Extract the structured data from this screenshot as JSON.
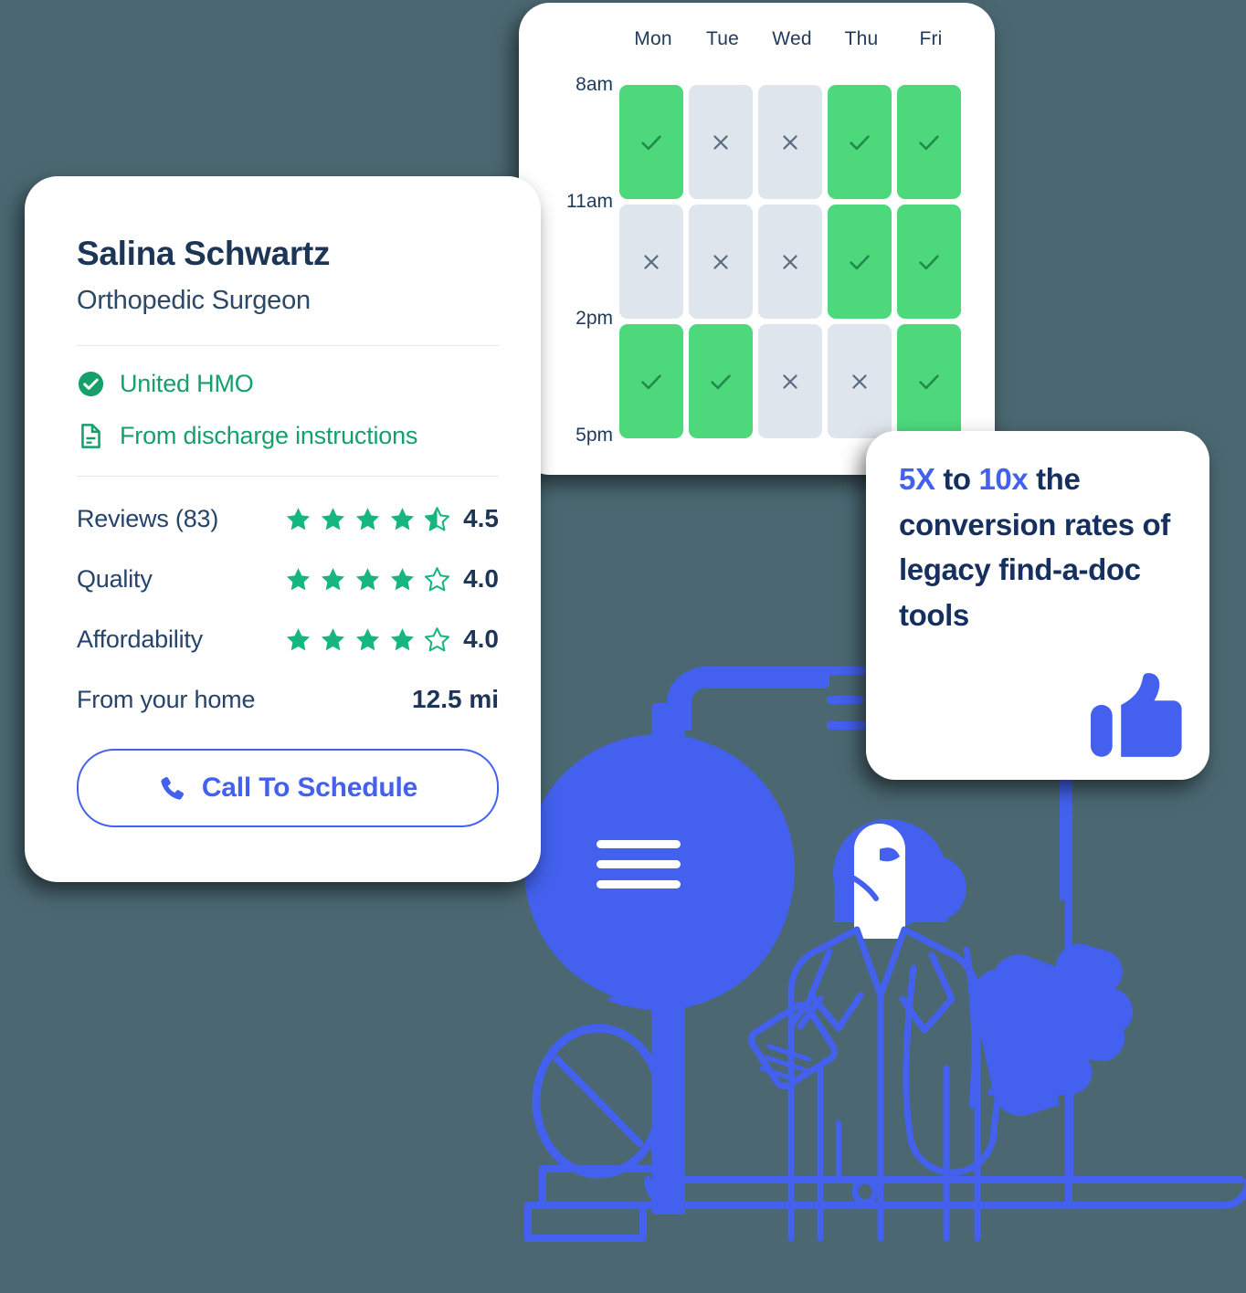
{
  "theme": {
    "background": "#4b6872",
    "card_bg": "#ffffff",
    "accent_blue": "#4361ee",
    "navy": "#1d3557",
    "green_open": "#4dd87b",
    "gray_closed": "#dfe5ec",
    "green_text": "#15a06a"
  },
  "schedule": {
    "days": [
      "Mon",
      "Tue",
      "Wed",
      "Thu",
      "Fri"
    ],
    "times": [
      "8am",
      "11am",
      "2pm",
      "5pm"
    ],
    "rows": [
      {
        "time_start": "8am",
        "time_end": "11am",
        "cells": [
          "available",
          "unavailable",
          "unavailable",
          "available",
          "available"
        ]
      },
      {
        "time_start": "11am",
        "time_end": "2pm",
        "cells": [
          "unavailable",
          "unavailable",
          "unavailable",
          "available",
          "available"
        ]
      },
      {
        "time_start": "2pm",
        "time_end": "5pm",
        "cells": [
          "available",
          "available",
          "unavailable",
          "unavailable",
          "available"
        ]
      }
    ],
    "icon_available": "check-icon",
    "icon_unavailable": "close-icon"
  },
  "profile": {
    "name": "Salina Schwartz",
    "specialty": "Orthopedic Surgeon",
    "tags": [
      {
        "icon": "check-circle-icon",
        "label": "United HMO"
      },
      {
        "icon": "document-icon",
        "label": "From discharge instructions"
      }
    ],
    "ratings": [
      {
        "label": "Reviews (83)",
        "stars": 4.5,
        "value": "4.5"
      },
      {
        "label": "Quality",
        "stars": 4.0,
        "value": "4.0"
      },
      {
        "label": "Affordability",
        "stars": 4.0,
        "value": "4.0"
      }
    ],
    "distance": {
      "label": "From your home",
      "value": "12.5 mi"
    },
    "cta": {
      "icon": "phone-icon",
      "label": "Call To Schedule"
    }
  },
  "stat": {
    "line1_highlight_a": "5X",
    "line1_mid": " to ",
    "line1_highlight_b": "10x",
    "line1_tail": " the",
    "line2": "conversion rates",
    "line3": "of legacy",
    "line4": "find-a-doc tools",
    "full_text": "5X to 10x the conversion rates of legacy find-a-doc tools",
    "icon": "thumbs-up-icon"
  },
  "illustration": {
    "name": "doctor-with-laptop-and-speech-bubble-illustration",
    "elements": [
      "laptop-outline",
      "speech-bubble",
      "doctor-figure",
      "id-badge",
      "stethoscope",
      "desk-lamp",
      "raised-hand"
    ]
  }
}
